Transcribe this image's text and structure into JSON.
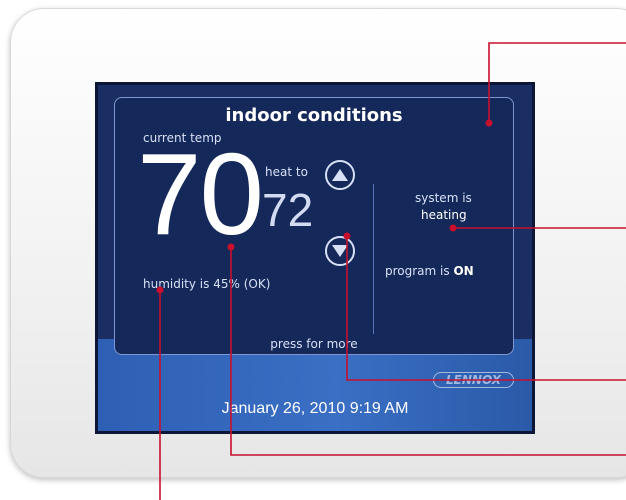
{
  "screen": {
    "title": "indoor conditions",
    "current_temp_label": "current temp",
    "current_temp": "70",
    "heat_to_label": "heat to",
    "setpoint": "72",
    "system_status_line1": "system is",
    "system_status_line2": "heating",
    "program_label": "program is",
    "program_value": "ON",
    "humidity": "humidity is 45% (OK)",
    "press_for_more": "press for more",
    "brand": "LENNOX",
    "datetime": "January 26, 2010  9:19 AM"
  },
  "icons": {
    "up": "triangle-up-icon",
    "down": "triangle-down-icon"
  },
  "colors": {
    "callout": "#c8102e",
    "screen_bg": "#1a2e63",
    "panel_bg": "#14285a"
  }
}
